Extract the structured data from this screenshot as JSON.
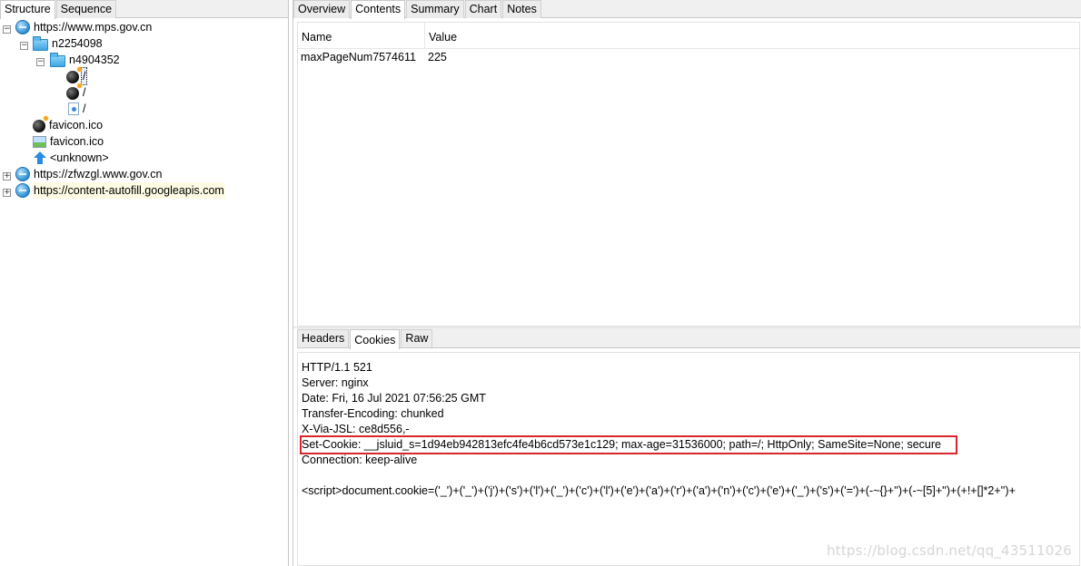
{
  "left_tabs": [
    "Structure",
    "Sequence"
  ],
  "tree": {
    "host1": "https://www.mps.gov.cn",
    "folder1": "n2254098",
    "folder2": "n4904352",
    "res1": "/",
    "res2": "/",
    "res3": "/",
    "favicon1": "favicon.ico",
    "favicon2": "favicon.ico",
    "unknown": "<unknown>",
    "host2": "https://zfwzgl.www.gov.cn",
    "host3": "https://content-autofill.googleapis.com",
    "expand_minus": "−",
    "expand_plus": "+"
  },
  "right_tabs": [
    "Overview",
    "Contents",
    "Summary",
    "Chart",
    "Notes"
  ],
  "grid": {
    "headers": [
      "Name",
      "Value"
    ],
    "rows": [
      {
        "name": "maxPageNum7574611",
        "value": "225"
      }
    ]
  },
  "bottom_tabs": [
    "Headers",
    "Cookies",
    "Raw"
  ],
  "raw": {
    "status": "HTTP/1.1 521",
    "server": "Server: nginx",
    "date": "Date: Fri, 16 Jul 2021 07:56:25 GMT",
    "transfer": "Transfer-Encoding: chunked",
    "xvia": "X-Via-JSL: ce8d556,-",
    "setcookie": "Set-Cookie: __jsluid_s=1d94eb942813efc4fe4b6cd573e1c129; max-age=31536000; path=/; HttpOnly; SameSite=None; secure",
    "connection": "Connection: keep-alive",
    "script": "<script>document.cookie=('_')+('_')+('j')+('s')+('l')+('_')+('c')+('l')+('e')+('a')+('r')+('a')+('n')+('c')+('e')+('_')+('s')+('=')+(-~{}+'')+(-~[5]+'')+(+!+[]*2+'')+"
  },
  "watermark": "https://blog.csdn.net/qq_43511026",
  "colors": {
    "highlight_box": "#d9262c",
    "selection": "#e8f0ff",
    "tree_highlight": "#fdfbe3"
  }
}
